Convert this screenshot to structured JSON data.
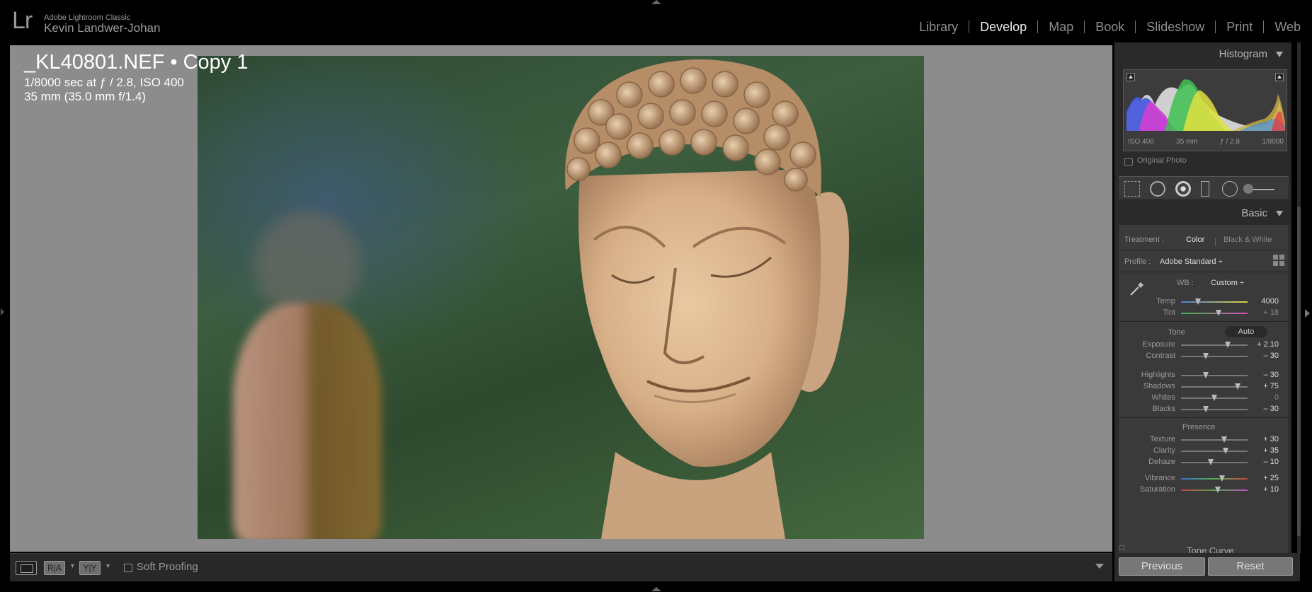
{
  "app": {
    "logo": "Lr",
    "name": "Adobe Lightroom Classic",
    "user": "Kevin Landwer-Johan"
  },
  "modules": [
    "Library",
    "Develop",
    "Map",
    "Book",
    "Slideshow",
    "Print",
    "Web"
  ],
  "active_module": "Develop",
  "photo": {
    "title": "_KL40801.NEF  •  Copy 1",
    "exposure": "1/8000 sec at ƒ / 2.8, ISO 400",
    "lens": "35 mm (35.0 mm f/1.4)"
  },
  "toolbar": {
    "ra": "R|A",
    "yy": "Y|Y",
    "soft_proofing": "Soft Proofing"
  },
  "histogram": {
    "title": "Histogram",
    "iso": "ISO 400",
    "focal": "35 mm",
    "aperture": "ƒ / 2.8",
    "shutter": "1/8000",
    "original_photo": "Original Photo"
  },
  "basic": {
    "title": "Basic",
    "treatment_label": "Treatment :",
    "treatment_color": "Color",
    "treatment_bw": "Black & White",
    "profile_label": "Profile :",
    "profile_value": "Adobe Standard ÷",
    "wb_label": "WB :",
    "wb_value": "Custom ÷",
    "tone_label": "Tone",
    "auto_label": "Auto",
    "presence_label": "Presence",
    "sliders": {
      "temp": {
        "label": "Temp",
        "value": "4000",
        "pos": 0.25
      },
      "tint": {
        "label": "Tint",
        "value": "+ 18",
        "pos": 0.56
      },
      "exposure": {
        "label": "Exposure",
        "value": "+ 2.10",
        "pos": 0.7
      },
      "contrast": {
        "label": "Contrast",
        "value": "– 30",
        "pos": 0.37
      },
      "highlights": {
        "label": "Highlights",
        "value": "– 30",
        "pos": 0.37
      },
      "shadows": {
        "label": "Shadows",
        "value": "+ 75",
        "pos": 0.85
      },
      "whites": {
        "label": "Whites",
        "value": "0",
        "pos": 0.5
      },
      "blacks": {
        "label": "Blacks",
        "value": "– 30",
        "pos": 0.37
      },
      "texture": {
        "label": "Texture",
        "value": "+ 30",
        "pos": 0.65
      },
      "clarity": {
        "label": "Clarity",
        "value": "+ 35",
        "pos": 0.67
      },
      "dehaze": {
        "label": "Dehaze",
        "value": "– 10",
        "pos": 0.45
      },
      "vibrance": {
        "label": "Vibrance",
        "value": "+ 25",
        "pos": 0.62
      },
      "saturation": {
        "label": "Saturation",
        "value": "+ 10",
        "pos": 0.55
      }
    }
  },
  "tone_curve": {
    "title": "Tone Curve"
  },
  "buttons": {
    "previous": "Previous",
    "reset": "Reset"
  }
}
